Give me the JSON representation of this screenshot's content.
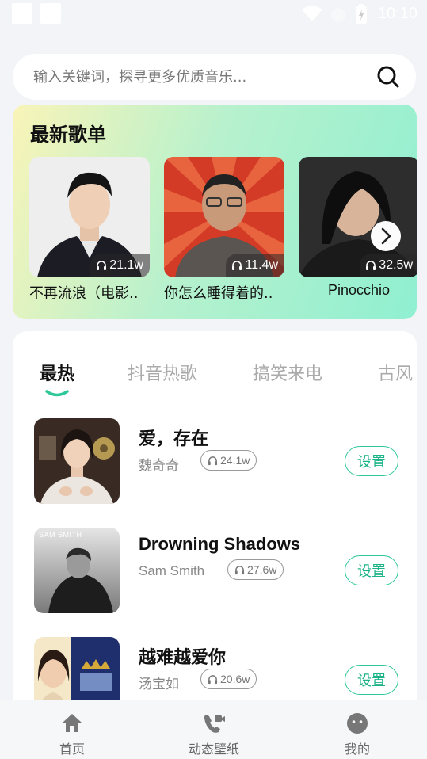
{
  "status_bar": {
    "time": "10:10"
  },
  "search": {
    "placeholder": "输入关键词，探寻更多优质音乐..."
  },
  "playlists": {
    "title": "最新歌单",
    "items": [
      {
        "name": "不再流浪（电影..",
        "plays": "21.1w"
      },
      {
        "name": "你怎么睡得着的..",
        "plays": "11.4w"
      },
      {
        "name": "Pinocchio",
        "plays": "32.5w"
      }
    ]
  },
  "tabs": [
    "最热",
    "抖音热歌",
    "搞笑来电",
    "古风"
  ],
  "songs": [
    {
      "title": "爱，存在",
      "artist": "魏奇奇",
      "plays": "24.1w",
      "action": "设置"
    },
    {
      "title": "Drowning Shadows",
      "artist": "Sam Smith",
      "plays": "27.6w",
      "action": "设置",
      "cover_text": "SAM SMITH"
    },
    {
      "title": "越难越爱你",
      "artist": "汤宝如",
      "plays": "20.6w",
      "action": "设置"
    }
  ],
  "nav": [
    {
      "label": "首页",
      "icon": "home-icon"
    },
    {
      "label": "动态壁纸",
      "icon": "video-call-icon"
    },
    {
      "label": "我的",
      "icon": "smiley-icon"
    }
  ],
  "colors": {
    "accent": "#2ec79a"
  }
}
